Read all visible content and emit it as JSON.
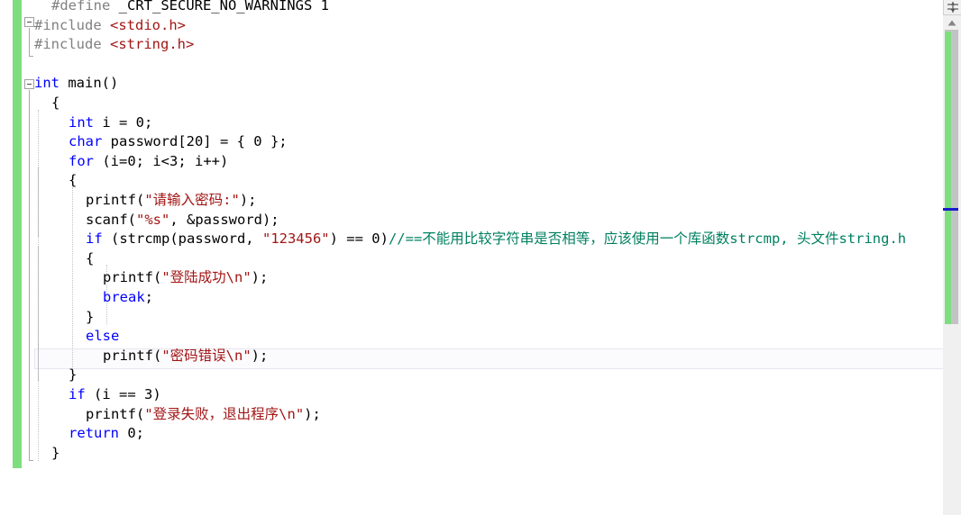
{
  "app": {
    "name": "visual-studio-code-editor",
    "language": "C"
  },
  "colors": {
    "keyword": "#0000ff",
    "string": "#a31515",
    "comment": "#008060",
    "preprocessor": "#808080",
    "header": "#a31515",
    "plain": "#000000",
    "change_bar": "#7ede7e",
    "caret_marker": "#1a1ad0",
    "current_line_bg": "#fbfbfe",
    "current_line_border": "#e6e6f0",
    "scrollbar_track": "#f0f0f0",
    "scrollbar_thumb": "#c3c3c7",
    "background": "#ffffff"
  },
  "editor": {
    "current_line_index": 16,
    "lines": [
      {
        "indent": 1,
        "tokens": [
          {
            "t": "pp",
            "v": "#define"
          },
          {
            "t": "plain",
            "v": " _CRT_SECURE_NO_WARNINGS 1"
          }
        ]
      },
      {
        "indent": 0,
        "tokens": [
          {
            "t": "pp",
            "v": "#include"
          },
          {
            "t": "plain",
            "v": " "
          },
          {
            "t": "hdr",
            "v": "<stdio.h>"
          }
        ]
      },
      {
        "indent": 0,
        "tokens": [
          {
            "t": "pp",
            "v": "#include"
          },
          {
            "t": "plain",
            "v": " "
          },
          {
            "t": "hdr",
            "v": "<string.h>"
          }
        ]
      },
      {
        "indent": 0,
        "tokens": []
      },
      {
        "indent": 0,
        "tokens": [
          {
            "t": "kw",
            "v": "int"
          },
          {
            "t": "plain",
            "v": " main()"
          }
        ]
      },
      {
        "indent": 1,
        "tokens": [
          {
            "t": "plain",
            "v": "{"
          }
        ]
      },
      {
        "indent": 2,
        "tokens": [
          {
            "t": "kw",
            "v": "int"
          },
          {
            "t": "plain",
            "v": " i = 0;"
          }
        ]
      },
      {
        "indent": 2,
        "tokens": [
          {
            "t": "kw",
            "v": "char"
          },
          {
            "t": "plain",
            "v": " password[20] = { 0 };"
          }
        ]
      },
      {
        "indent": 2,
        "tokens": [
          {
            "t": "kw",
            "v": "for"
          },
          {
            "t": "plain",
            "v": " (i=0; i<3; i++)"
          }
        ]
      },
      {
        "indent": 2,
        "tokens": [
          {
            "t": "plain",
            "v": "{"
          }
        ]
      },
      {
        "indent": 3,
        "tokens": [
          {
            "t": "plain",
            "v": "printf("
          },
          {
            "t": "str",
            "v": "\"请输入密码:\""
          },
          {
            "t": "plain",
            "v": ");"
          }
        ]
      },
      {
        "indent": 3,
        "tokens": [
          {
            "t": "plain",
            "v": "scanf("
          },
          {
            "t": "str",
            "v": "\"%s\""
          },
          {
            "t": "plain",
            "v": ", &password);"
          }
        ]
      },
      {
        "indent": 3,
        "tokens": [
          {
            "t": "kw",
            "v": "if"
          },
          {
            "t": "plain",
            "v": " (strcmp(password, "
          },
          {
            "t": "str",
            "v": "\"123456\""
          },
          {
            "t": "plain",
            "v": ") == 0)"
          },
          {
            "t": "cmt",
            "v": "//==不能用比较字符串是否相等，应该使用一个库函数strcmp, 头文件string.h"
          }
        ]
      },
      {
        "indent": 3,
        "tokens": [
          {
            "t": "plain",
            "v": "{"
          }
        ]
      },
      {
        "indent": 4,
        "tokens": [
          {
            "t": "plain",
            "v": "printf("
          },
          {
            "t": "str",
            "v": "\"登陆成功\\n\""
          },
          {
            "t": "plain",
            "v": ");"
          }
        ]
      },
      {
        "indent": 4,
        "tokens": [
          {
            "t": "kw",
            "v": "break"
          },
          {
            "t": "plain",
            "v": ";"
          }
        ]
      },
      {
        "indent": 3,
        "tokens": [
          {
            "t": "plain",
            "v": "}"
          }
        ]
      },
      {
        "indent": 3,
        "tokens": [
          {
            "t": "kw",
            "v": "else"
          }
        ]
      },
      {
        "indent": 4,
        "tokens": [
          {
            "t": "plain",
            "v": "printf("
          },
          {
            "t": "str",
            "v": "\"密码错误\\n\""
          },
          {
            "t": "plain",
            "v": ");"
          }
        ]
      },
      {
        "indent": 2,
        "tokens": [
          {
            "t": "plain",
            "v": "}"
          }
        ]
      },
      {
        "indent": 2,
        "tokens": [
          {
            "t": "kw",
            "v": "if"
          },
          {
            "t": "plain",
            "v": " (i == 3)"
          }
        ]
      },
      {
        "indent": 3,
        "tokens": [
          {
            "t": "plain",
            "v": "printf("
          },
          {
            "t": "str",
            "v": "\"登录失败，退出程序\\n\""
          },
          {
            "t": "plain",
            "v": ");"
          }
        ]
      },
      {
        "indent": 2,
        "tokens": [
          {
            "t": "kw",
            "v": "return"
          },
          {
            "t": "plain",
            "v": " 0;"
          }
        ]
      },
      {
        "indent": 1,
        "tokens": [
          {
            "t": "plain",
            "v": "}"
          }
        ]
      }
    ],
    "plain_text_lines": [
      "#define _CRT_SECURE_NO_WARNINGS 1",
      "#include <stdio.h>",
      "#include <string.h>",
      "",
      "int main()",
      "{",
      "    int i = 0;",
      "    char password[20] = { 0 };",
      "    for (i=0; i<3; i++)",
      "    {",
      "        printf(\"请输入密码:\");",
      "        scanf(\"%s\", &password);",
      "        if (strcmp(password, \"123456\") == 0)//==不能用比较字符串是否相等，应该使用一个库函数strcmp, 头文件string.h",
      "        {",
      "            printf(\"登陆成功\\n\");",
      "            break;",
      "        }",
      "        else",
      "            printf(\"密码错误\\n\");",
      "    }",
      "    if (i == 3)",
      "        printf(\"登录失败，退出程序\\n\");",
      "    return 0;",
      "}"
    ]
  },
  "fold_boxes": [
    {
      "line": 1,
      "label": "collapse-include-block"
    },
    {
      "line": 4,
      "label": "collapse-main-function"
    },
    {
      "line": 8,
      "label": "collapse-for-loop"
    },
    {
      "line": 12,
      "label": "collapse-if-block"
    }
  ],
  "scrollbar": {
    "split_handle": "split-window-handle",
    "up_arrow": "scroll-up-arrow",
    "thumb_label": "vertical-scroll-thumb",
    "change_marker_label": "unsaved-changes-marker",
    "caret_marker_label": "caret-position-marker"
  }
}
